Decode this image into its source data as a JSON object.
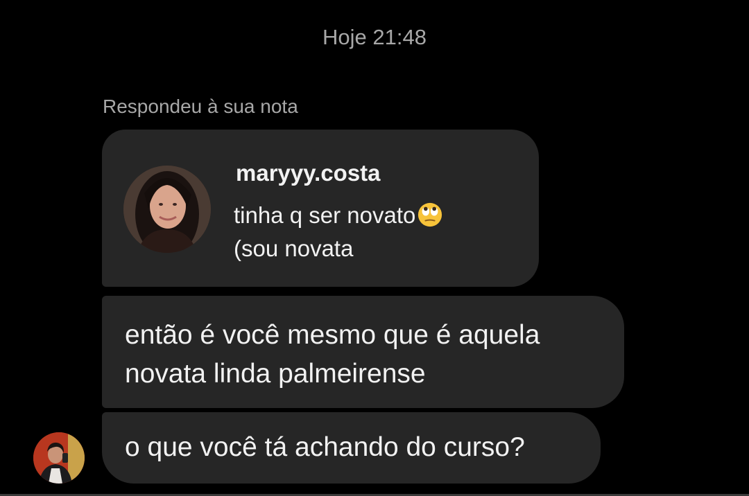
{
  "chat": {
    "timestamp": "Hoje 21:48",
    "reply_label": "Respondeu à sua nota",
    "note": {
      "username": "maryyy.costa",
      "line1": "tinha q ser  novato",
      "line1_emoji": "face-with-rolling-eyes-icon",
      "line2": "(sou novata"
    },
    "messages": [
      {
        "line1": "então é você mesmo que é aquela",
        "line2": "novata linda palmeirense"
      },
      {
        "text": "o que você tá achando do curso?"
      }
    ]
  },
  "colors": {
    "background": "#000000",
    "bubble": "#262626",
    "muted_text": "#a8a8a8",
    "text": "#f2f2f2"
  }
}
